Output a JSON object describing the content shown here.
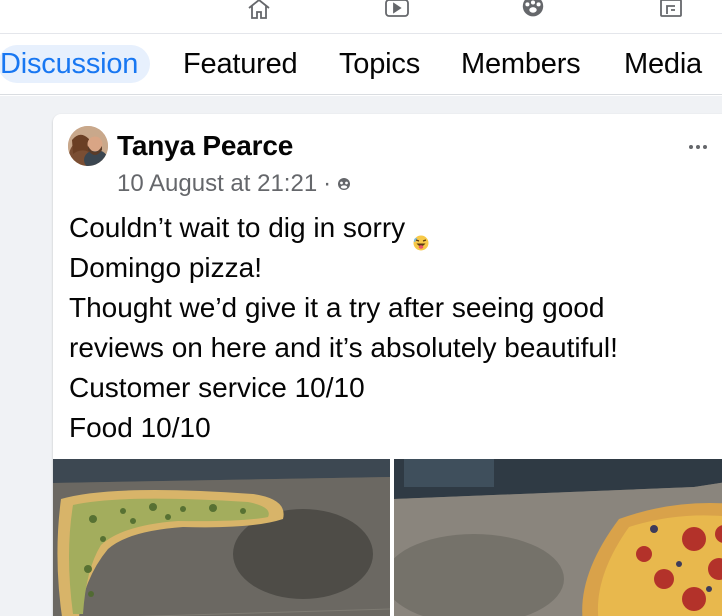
{
  "topnav": {
    "icons": [
      "home-icon",
      "video-icon",
      "community-icon",
      "pages-icon"
    ]
  },
  "tabs": [
    {
      "label": "Discussion",
      "active": true
    },
    {
      "label": "Featured",
      "active": false
    },
    {
      "label": "Topics",
      "active": false
    },
    {
      "label": "Members",
      "active": false
    },
    {
      "label": "Media",
      "active": false
    }
  ],
  "post": {
    "author": "Tanya Pearce",
    "timestamp": "10 August at 21:21",
    "separator": "·",
    "audience_icon": "group-audience-icon",
    "more_icon": "more-options-icon",
    "lines": [
      "Couldn’t wait to dig in sorry",
      "Domingo pizza!",
      "Thought we’d give it a try after seeing good",
      "reviews on here and it’s absolutely beautiful!",
      "Customer service 10/10",
      "Food 10/10"
    ],
    "emoji": "face-with-tongue-emoji",
    "photos": [
      "pizza-photo-left",
      "pizza-photo-right"
    ]
  },
  "colors": {
    "accent": "#1877f2",
    "accent_bg": "#e7f0fd",
    "feed_bg": "#f0f2f5",
    "text": "#050505",
    "secondary_text": "#65676b"
  }
}
